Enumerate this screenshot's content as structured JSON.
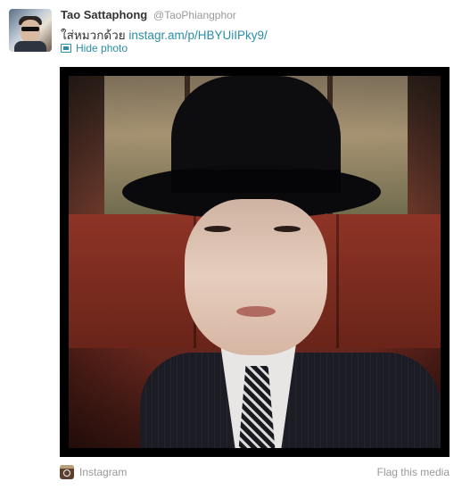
{
  "tweet": {
    "author_name": "Tao Sattaphong",
    "author_handle": "@TaoPhiangphor",
    "text": "ใส่หมวกด้วย",
    "link": "instagr.am/p/HBYUiIPky9/",
    "hide_photo_label": "Hide photo"
  },
  "media": {
    "source_label": "Instagram",
    "flag_label": "Flag this media"
  },
  "colors": {
    "link": "#2a8ea8",
    "text": "#333333",
    "muted": "#999999"
  },
  "icons": [
    "avatar",
    "photo-icon",
    "instagram-icon"
  ]
}
